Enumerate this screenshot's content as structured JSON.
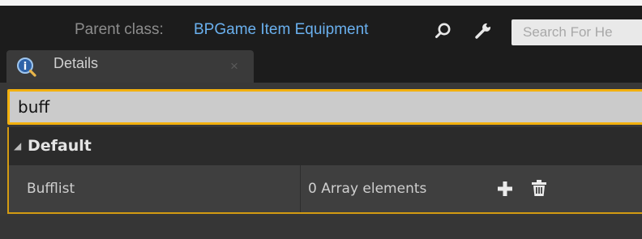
{
  "toolbar": {
    "parent_class_label": "Parent class:",
    "parent_class_value": "BPGame Item Equipment",
    "find_icon": "magnifier-icon",
    "edit_icon": "wrench-icon",
    "search_placeholder": "Search For He"
  },
  "details_tab": {
    "icon": "details-info-icon",
    "label": "Details",
    "close_label": "×"
  },
  "filter": {
    "value": "buff"
  },
  "category": {
    "arrow": "◢",
    "label": "Default"
  },
  "property": {
    "name": "Bufflist",
    "value": "0 Array elements",
    "add_icon": "plus-icon",
    "clear_icon": "trash-icon"
  },
  "colors": {
    "accent": "#f2b00e",
    "link": "#6ab0ee",
    "panel": "#3f3f3f",
    "header": "#1c1c1c"
  }
}
